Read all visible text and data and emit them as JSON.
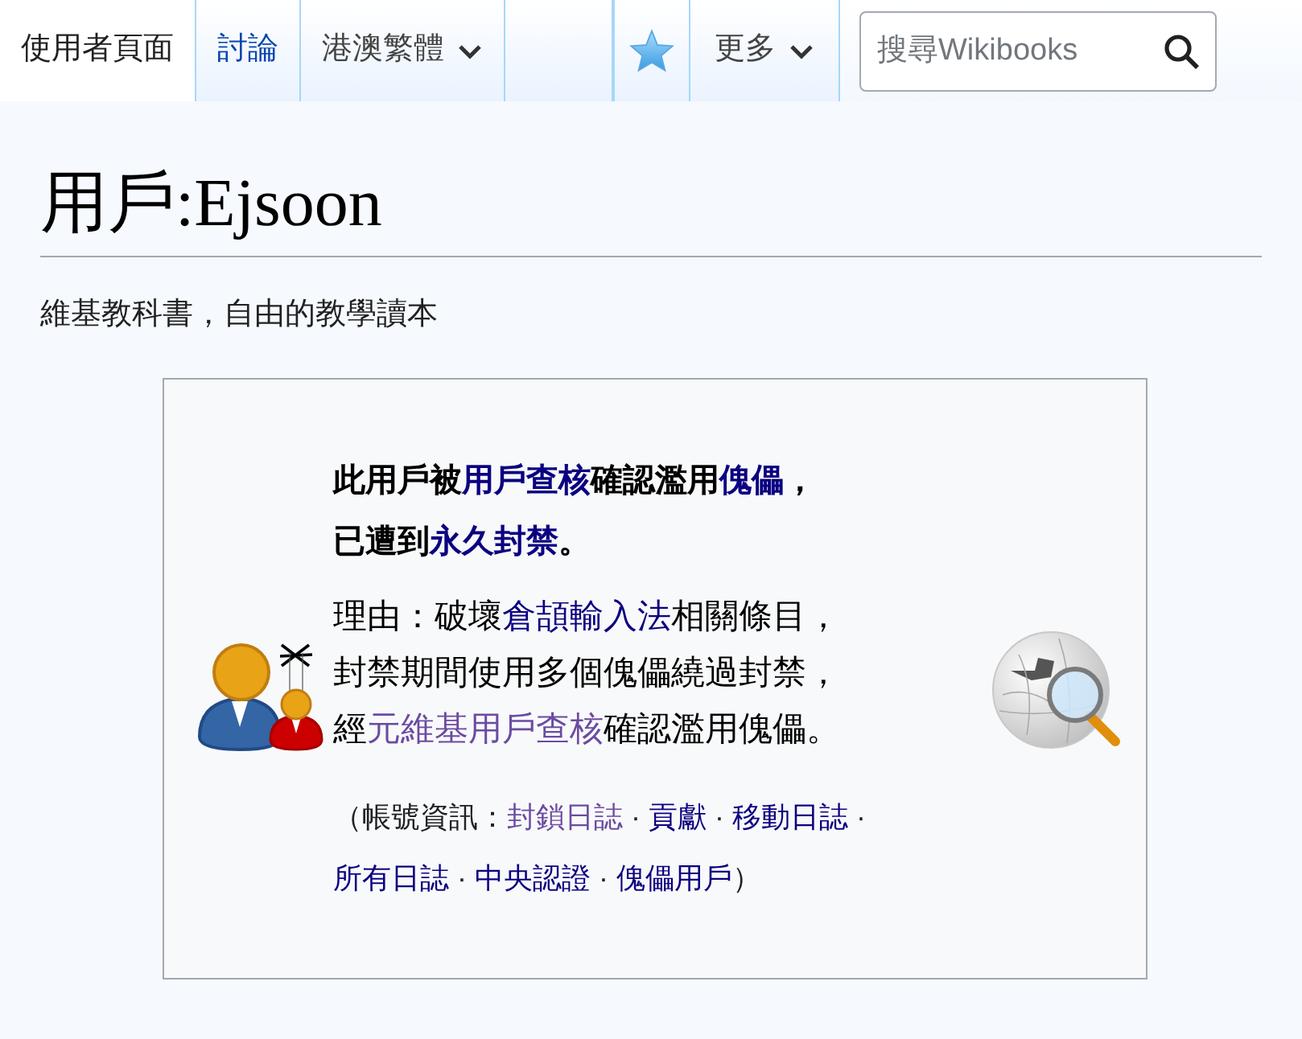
{
  "tabs": [
    {
      "label": "使用者頁面",
      "selected": true,
      "kind": "tab"
    },
    {
      "label": "討論",
      "selected": false,
      "kind": "tab"
    },
    {
      "label": "港澳繁體",
      "selected": false,
      "kind": "dropdown"
    }
  ],
  "actions": [
    {
      "kind": "star"
    },
    {
      "kind": "dropdown",
      "label": "更多"
    }
  ],
  "search": {
    "placeholder": "搜尋Wikibooks"
  },
  "title": "用戶:Ejsoon",
  "subtitle": "維基教科書，自由的教學讀本",
  "notice": {
    "headline": [
      [
        {
          "text": "此用戶被",
          "kind": "text"
        },
        {
          "text": "用戶查核",
          "kind": "link"
        },
        {
          "text": "確認濫用",
          "kind": "text"
        },
        {
          "text": "傀儡",
          "kind": "link"
        },
        {
          "text": "，",
          "kind": "text"
        }
      ],
      [
        {
          "text": "已遭到",
          "kind": "text"
        },
        {
          "text": "永久封禁",
          "kind": "link"
        },
        {
          "text": "。",
          "kind": "text"
        }
      ]
    ],
    "reason": [
      [
        {
          "text": "理由：破壞",
          "kind": "text"
        },
        {
          "text": "倉頡輸入法",
          "kind": "link"
        },
        {
          "text": "相關條目，",
          "kind": "text"
        }
      ],
      [
        {
          "text": "封禁期間使用多個傀儡繞過封禁，",
          "kind": "text"
        }
      ],
      [
        {
          "text": "經",
          "kind": "text"
        },
        {
          "text": "元維基用戶查核",
          "kind": "external_link"
        },
        {
          "text": "確認濫用傀儡。",
          "kind": "text"
        }
      ]
    ],
    "account_info": [
      {
        "text": "（帳號資訊：",
        "kind": "text"
      },
      {
        "text": "封鎖日誌",
        "kind": "visited_link"
      },
      {
        "text": " · ",
        "kind": "text"
      },
      {
        "text": "貢獻",
        "kind": "link"
      },
      {
        "text": " · ",
        "kind": "text"
      },
      {
        "text": "移動日誌",
        "kind": "link"
      },
      {
        "text": " · ",
        "kind": "text"
      },
      {
        "text": "所有日誌",
        "kind": "link"
      },
      {
        "text": " · ",
        "kind": "text"
      },
      {
        "text": "中央認證",
        "kind": "link"
      },
      {
        "text": " · ",
        "kind": "text"
      },
      {
        "text": "傀儡用戶",
        "kind": "link"
      },
      {
        "text": "）",
        "kind": "text"
      }
    ]
  }
}
